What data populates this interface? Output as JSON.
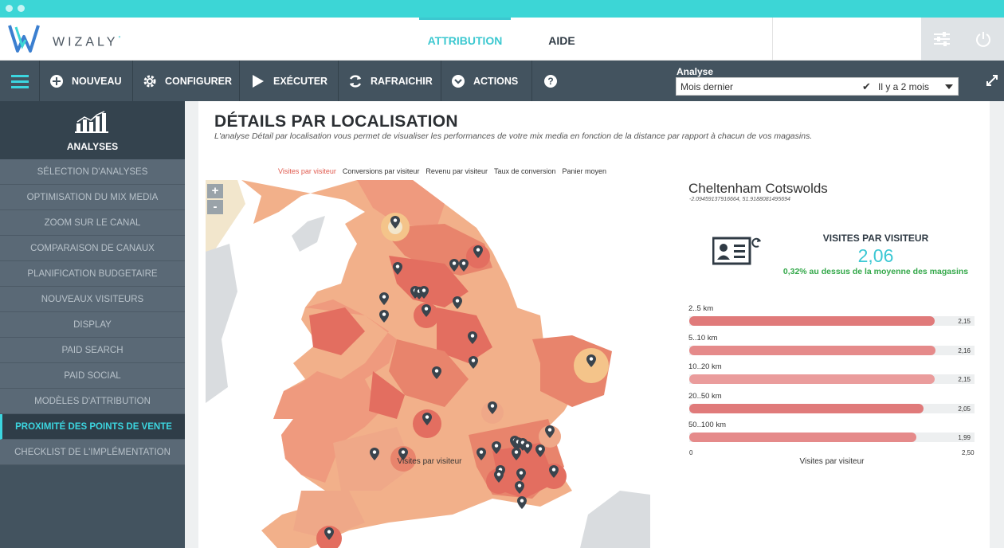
{
  "brand": {
    "name": "WIZALY",
    "registered": "°"
  },
  "nav": {
    "tabs": [
      {
        "label": "ATTRIBUTION"
      },
      {
        "label": "AIDE"
      }
    ]
  },
  "toolbar": {
    "buttons": [
      {
        "label": "NOUVEAU",
        "icon": "plus-circle-icon"
      },
      {
        "label": "CONFIGURER",
        "icon": "gear-icon"
      },
      {
        "label": "EXÉCUTER",
        "icon": "play-icon"
      },
      {
        "label": "RAFRAICHIR",
        "icon": "refresh-icon"
      },
      {
        "label": "ACTIONS",
        "icon": "chevron-circle-icon"
      }
    ],
    "analyse_label": "Analyse",
    "analyse_value": "Mois dernier",
    "analyse_relative": "Il y a 2 mois"
  },
  "sidebar": {
    "header": "ANALYSES",
    "items": [
      "SÉLECTION D'ANALYSES",
      "OPTIMISATION DU MIX MEDIA",
      "ZOOM SUR LE CANAL",
      "COMPARAISON DE CANAUX",
      "PLANIFICATION BUDGETAIRE",
      "NOUVEAUX VISITEURS",
      "DISPLAY",
      "PAID SEARCH",
      "PAID SOCIAL",
      "MODÈLES D'ATTRIBUTION",
      "PROXIMITÉ DES POINTS DE VENTE",
      "CHECKLIST DE L'IMPLÉMENTATION"
    ],
    "active_index": 10
  },
  "page": {
    "title": "DÉTAILS PAR LOCALISATION",
    "subtitle": "L'analyse Détail par localisation vous permet de visualiser les performances de votre mix media en fonction de la distance par rapport à chacun de vos magasins."
  },
  "map": {
    "tabs": [
      "Visites par visiteur",
      "Conversions par visiteur",
      "Revenu par visiteur",
      "Taux de conversion",
      "Panier moyen"
    ],
    "active_tab": 0,
    "zoom_in": "+",
    "zoom_out": "-",
    "label": "Visites par visiteur"
  },
  "store": {
    "name": "Cheltenham Cotswolds",
    "coords": "-2.09459137916664, 51.9188081495694",
    "metric_title": "VISITES PAR VISITEUR",
    "metric_value": "2,06",
    "metric_note": "0,32% au dessus de la moyenne des magasins"
  },
  "chart_data": {
    "type": "bar",
    "orientation": "horizontal",
    "categories": [
      "2..5 km",
      "5..10 km",
      "10..20 km",
      "20..50 km",
      "50..100 km"
    ],
    "values": [
      2.15,
      2.16,
      2.15,
      2.05,
      1.99
    ],
    "value_labels": [
      "2,15",
      "2,16",
      "2,15",
      "2,05",
      "1,99"
    ],
    "xlim": [
      0,
      2.5
    ],
    "tick_labels": [
      "0",
      "2,50"
    ],
    "xlabel": "Visites par visiteur",
    "colors": [
      "#e07a7a",
      "#e58a8a",
      "#ea9c9c",
      "#e07a7a",
      "#e58a8a"
    ]
  }
}
